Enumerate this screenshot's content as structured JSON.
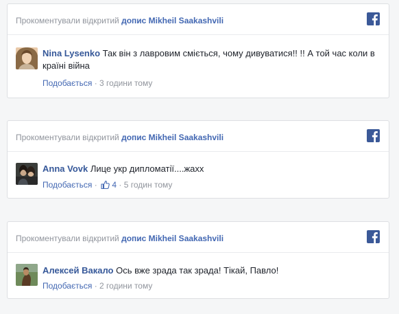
{
  "cards": [
    {
      "header_prefix": "Прокоментували відкритий",
      "header_link": "допис Mikheil Saakashvili",
      "author": "Nina Lysenko",
      "text": "Так він з лавровим сміється, чому дивуватися!! !! А той час коли в країні війна",
      "like_label": "Подобається",
      "separator": "·",
      "time": "3 години тому"
    },
    {
      "header_prefix": "Прокоментували відкритий",
      "header_link": "допис Mikheil Saakashvili",
      "author": "Anna Vovk",
      "text": "Лице укр дипломатії....жахх",
      "like_label": "Подобається",
      "separator": "·",
      "likes_count": "4",
      "time": "5 годин тому"
    },
    {
      "header_prefix": "Прокоментували відкритий",
      "header_link": "допис Mikheil Saakashvili",
      "author": "Алексей Вакало",
      "text": "Ось вже зрада так зрада! Тікай, Павло!",
      "like_label": "Подобається",
      "separator": "·",
      "time": "2 години тому"
    }
  ],
  "icons": {
    "facebook": "facebook-icon",
    "like_thumb": "thumbs-up-icon"
  },
  "colors": {
    "facebook_blue": "#3b5998",
    "link_blue": "#4267b2",
    "author_blue": "#365899",
    "meta_gray": "#90949c",
    "text": "#1d2129"
  }
}
